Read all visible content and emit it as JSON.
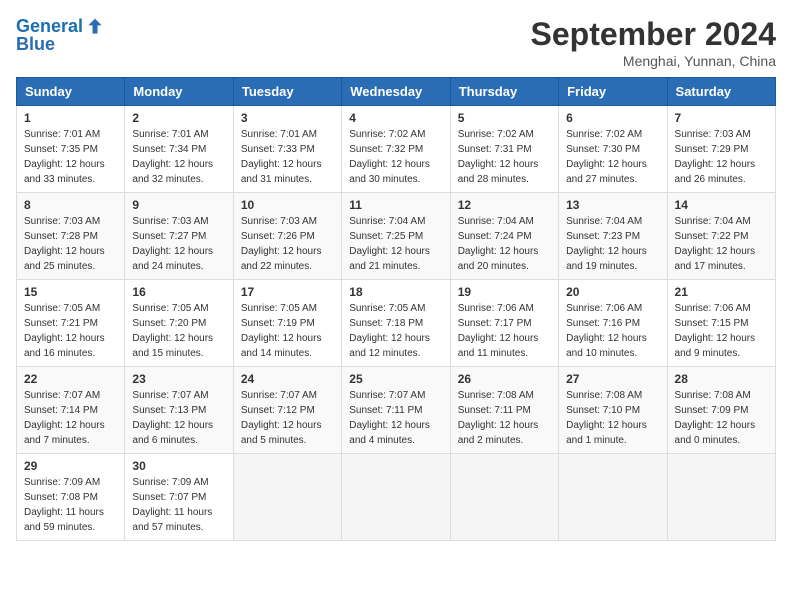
{
  "header": {
    "logo_line1": "General",
    "logo_line2": "Blue",
    "month_title": "September 2024",
    "subtitle": "Menghai, Yunnan, China"
  },
  "weekdays": [
    "Sunday",
    "Monday",
    "Tuesday",
    "Wednesday",
    "Thursday",
    "Friday",
    "Saturday"
  ],
  "weeks": [
    [
      {
        "day": "1",
        "sunrise": "7:01 AM",
        "sunset": "7:35 PM",
        "daylight": "12 hours and 33 minutes."
      },
      {
        "day": "2",
        "sunrise": "7:01 AM",
        "sunset": "7:34 PM",
        "daylight": "12 hours and 32 minutes."
      },
      {
        "day": "3",
        "sunrise": "7:01 AM",
        "sunset": "7:33 PM",
        "daylight": "12 hours and 31 minutes."
      },
      {
        "day": "4",
        "sunrise": "7:02 AM",
        "sunset": "7:32 PM",
        "daylight": "12 hours and 30 minutes."
      },
      {
        "day": "5",
        "sunrise": "7:02 AM",
        "sunset": "7:31 PM",
        "daylight": "12 hours and 28 minutes."
      },
      {
        "day": "6",
        "sunrise": "7:02 AM",
        "sunset": "7:30 PM",
        "daylight": "12 hours and 27 minutes."
      },
      {
        "day": "7",
        "sunrise": "7:03 AM",
        "sunset": "7:29 PM",
        "daylight": "12 hours and 26 minutes."
      }
    ],
    [
      {
        "day": "8",
        "sunrise": "7:03 AM",
        "sunset": "7:28 PM",
        "daylight": "12 hours and 25 minutes."
      },
      {
        "day": "9",
        "sunrise": "7:03 AM",
        "sunset": "7:27 PM",
        "daylight": "12 hours and 24 minutes."
      },
      {
        "day": "10",
        "sunrise": "7:03 AM",
        "sunset": "7:26 PM",
        "daylight": "12 hours and 22 minutes."
      },
      {
        "day": "11",
        "sunrise": "7:04 AM",
        "sunset": "7:25 PM",
        "daylight": "12 hours and 21 minutes."
      },
      {
        "day": "12",
        "sunrise": "7:04 AM",
        "sunset": "7:24 PM",
        "daylight": "12 hours and 20 minutes."
      },
      {
        "day": "13",
        "sunrise": "7:04 AM",
        "sunset": "7:23 PM",
        "daylight": "12 hours and 19 minutes."
      },
      {
        "day": "14",
        "sunrise": "7:04 AM",
        "sunset": "7:22 PM",
        "daylight": "12 hours and 17 minutes."
      }
    ],
    [
      {
        "day": "15",
        "sunrise": "7:05 AM",
        "sunset": "7:21 PM",
        "daylight": "12 hours and 16 minutes."
      },
      {
        "day": "16",
        "sunrise": "7:05 AM",
        "sunset": "7:20 PM",
        "daylight": "12 hours and 15 minutes."
      },
      {
        "day": "17",
        "sunrise": "7:05 AM",
        "sunset": "7:19 PM",
        "daylight": "12 hours and 14 minutes."
      },
      {
        "day": "18",
        "sunrise": "7:05 AM",
        "sunset": "7:18 PM",
        "daylight": "12 hours and 12 minutes."
      },
      {
        "day": "19",
        "sunrise": "7:06 AM",
        "sunset": "7:17 PM",
        "daylight": "12 hours and 11 minutes."
      },
      {
        "day": "20",
        "sunrise": "7:06 AM",
        "sunset": "7:16 PM",
        "daylight": "12 hours and 10 minutes."
      },
      {
        "day": "21",
        "sunrise": "7:06 AM",
        "sunset": "7:15 PM",
        "daylight": "12 hours and 9 minutes."
      }
    ],
    [
      {
        "day": "22",
        "sunrise": "7:07 AM",
        "sunset": "7:14 PM",
        "daylight": "12 hours and 7 minutes."
      },
      {
        "day": "23",
        "sunrise": "7:07 AM",
        "sunset": "7:13 PM",
        "daylight": "12 hours and 6 minutes."
      },
      {
        "day": "24",
        "sunrise": "7:07 AM",
        "sunset": "7:12 PM",
        "daylight": "12 hours and 5 minutes."
      },
      {
        "day": "25",
        "sunrise": "7:07 AM",
        "sunset": "7:11 PM",
        "daylight": "12 hours and 4 minutes."
      },
      {
        "day": "26",
        "sunrise": "7:08 AM",
        "sunset": "7:11 PM",
        "daylight": "12 hours and 2 minutes."
      },
      {
        "day": "27",
        "sunrise": "7:08 AM",
        "sunset": "7:10 PM",
        "daylight": "12 hours and 1 minute."
      },
      {
        "day": "28",
        "sunrise": "7:08 AM",
        "sunset": "7:09 PM",
        "daylight": "12 hours and 0 minutes."
      }
    ],
    [
      {
        "day": "29",
        "sunrise": "7:09 AM",
        "sunset": "7:08 PM",
        "daylight": "11 hours and 59 minutes."
      },
      {
        "day": "30",
        "sunrise": "7:09 AM",
        "sunset": "7:07 PM",
        "daylight": "11 hours and 57 minutes."
      },
      null,
      null,
      null,
      null,
      null
    ]
  ]
}
